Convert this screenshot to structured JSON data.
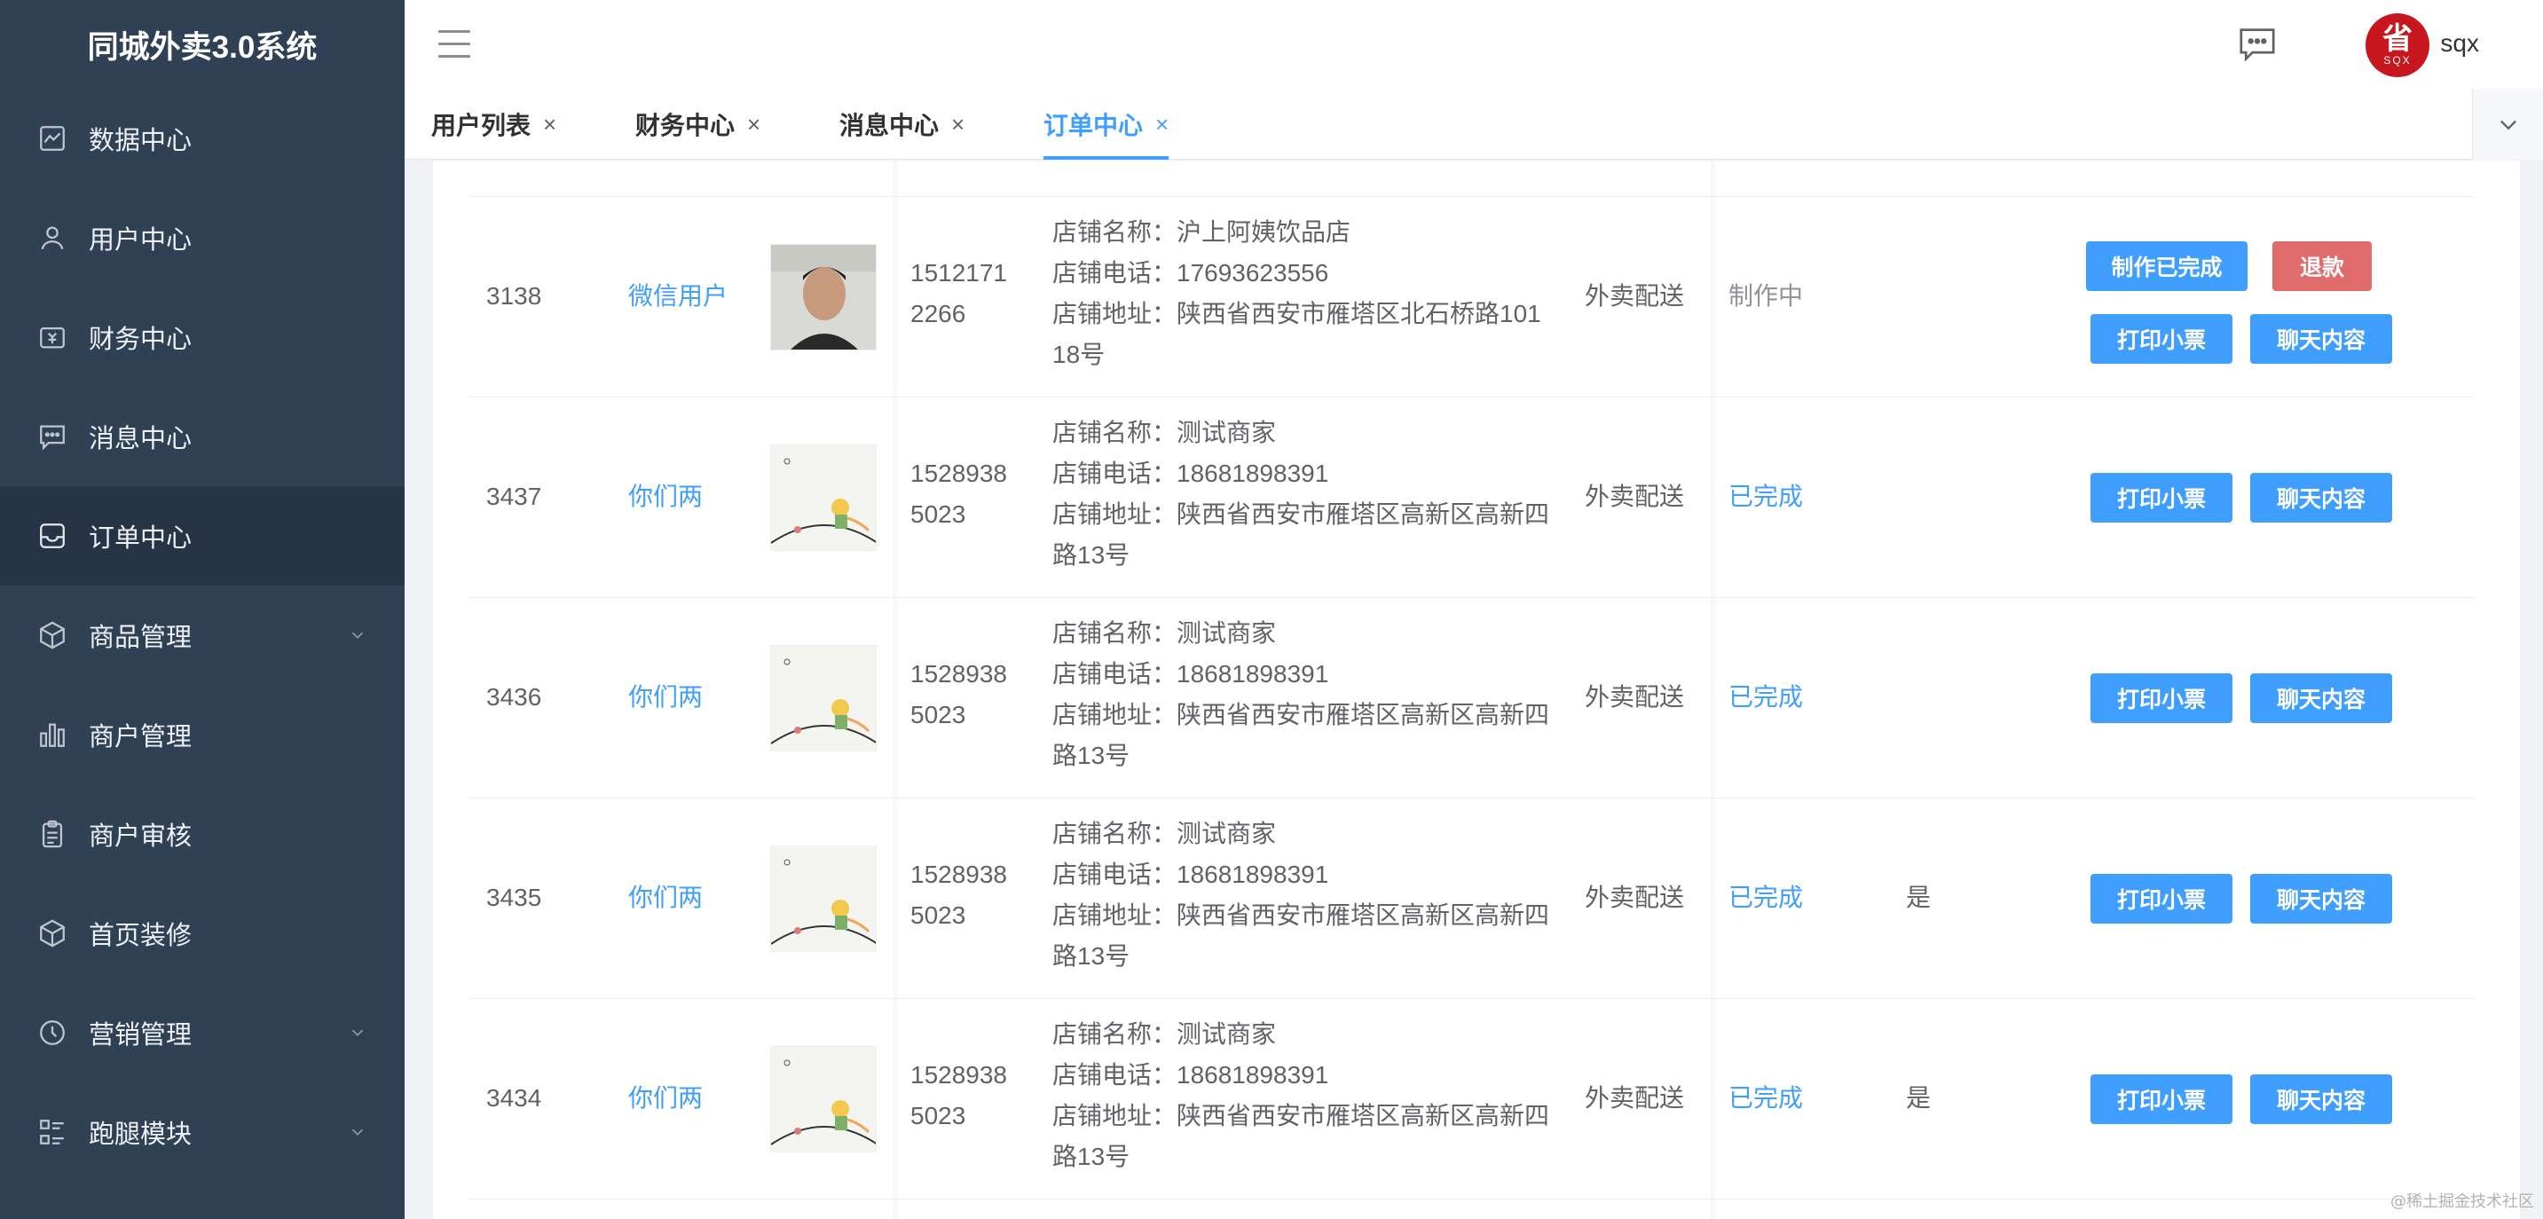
{
  "brand": "同城外卖3.0系统",
  "sidebar": {
    "items": [
      {
        "label": "数据中心",
        "icon": "chart-icon"
      },
      {
        "label": "用户中心",
        "icon": "user-icon"
      },
      {
        "label": "财务中心",
        "icon": "wallet-icon"
      },
      {
        "label": "消息中心",
        "icon": "message-icon"
      },
      {
        "label": "订单中心",
        "icon": "inbox-icon",
        "active": true
      },
      {
        "label": "商品管理",
        "icon": "box-icon",
        "expandable": true
      },
      {
        "label": "商户管理",
        "icon": "bar-chart-icon"
      },
      {
        "label": "商户审核",
        "icon": "clipboard-icon"
      },
      {
        "label": "首页装修",
        "icon": "box-icon"
      },
      {
        "label": "营销管理",
        "icon": "clock-icon",
        "expandable": true
      },
      {
        "label": "跑腿模块",
        "icon": "list-icon",
        "expandable": true
      }
    ]
  },
  "header": {
    "avatar_text": "省",
    "avatar_sub": "SQX",
    "username": "sqx"
  },
  "tabs": [
    {
      "label": "用户列表",
      "close": "×"
    },
    {
      "label": "财务中心",
      "close": "×"
    },
    {
      "label": "消息中心",
      "close": "×"
    },
    {
      "label": "订单中心",
      "close": "×",
      "active": true
    }
  ],
  "orders": [
    {
      "id": "3138",
      "user": "微信用户",
      "avatar": "photo",
      "phone_1": "1512171",
      "phone_2": "2266",
      "shop_name": "店铺名称：沪上阿姨饮品店",
      "shop_phone": "店铺电话：17693623556",
      "shop_addr": "店铺地址：陕西省西安市雁塔区北石桥路101",
      "shop_addr_2": "18号",
      "delivery": "外卖配送",
      "status": "制作中",
      "flag": "",
      "buttons": [
        "制作已完成",
        "退款",
        "打印小票",
        "聊天内容"
      ]
    },
    {
      "id": "3437",
      "user": "你们两",
      "avatar": "prince",
      "phone_1": "1528938",
      "phone_2": "5023",
      "shop_name": "店铺名称：测试商家",
      "shop_phone": "店铺电话：18681898391",
      "shop_addr": "店铺地址：陕西省西安市雁塔区高新区高新四",
      "shop_addr_2": "路13号",
      "delivery": "外卖配送",
      "status": "已完成",
      "flag": "",
      "buttons": [
        "打印小票",
        "聊天内容"
      ]
    },
    {
      "id": "3436",
      "user": "你们两",
      "avatar": "prince",
      "phone_1": "1528938",
      "phone_2": "5023",
      "shop_name": "店铺名称：测试商家",
      "shop_phone": "店铺电话：18681898391",
      "shop_addr": "店铺地址：陕西省西安市雁塔区高新区高新四",
      "shop_addr_2": "路13号",
      "delivery": "外卖配送",
      "status": "已完成",
      "flag": "",
      "buttons": [
        "打印小票",
        "聊天内容"
      ]
    },
    {
      "id": "3435",
      "user": "你们两",
      "avatar": "prince",
      "phone_1": "1528938",
      "phone_2": "5023",
      "shop_name": "店铺名称：测试商家",
      "shop_phone": "店铺电话：18681898391",
      "shop_addr": "店铺地址：陕西省西安市雁塔区高新区高新四",
      "shop_addr_2": "路13号",
      "delivery": "外卖配送",
      "status": "已完成",
      "flag": "是",
      "buttons": [
        "打印小票",
        "聊天内容"
      ]
    },
    {
      "id": "3434",
      "user": "你们两",
      "avatar": "prince",
      "phone_1": "1528938",
      "phone_2": "5023",
      "shop_name": "店铺名称：测试商家",
      "shop_phone": "店铺电话：18681898391",
      "shop_addr": "店铺地址：陕西省西安市雁塔区高新区高新四",
      "shop_addr_2": "路13号",
      "delivery": "外卖配送",
      "status": "已完成",
      "flag": "是",
      "buttons": [
        "打印小票",
        "聊天内容"
      ]
    }
  ],
  "watermark": "@稀土掘金技术社区",
  "colors": {
    "sidebar": "#304156",
    "sidebar_active": "#263445",
    "accent": "#409eff",
    "danger": "#e06b6b"
  }
}
